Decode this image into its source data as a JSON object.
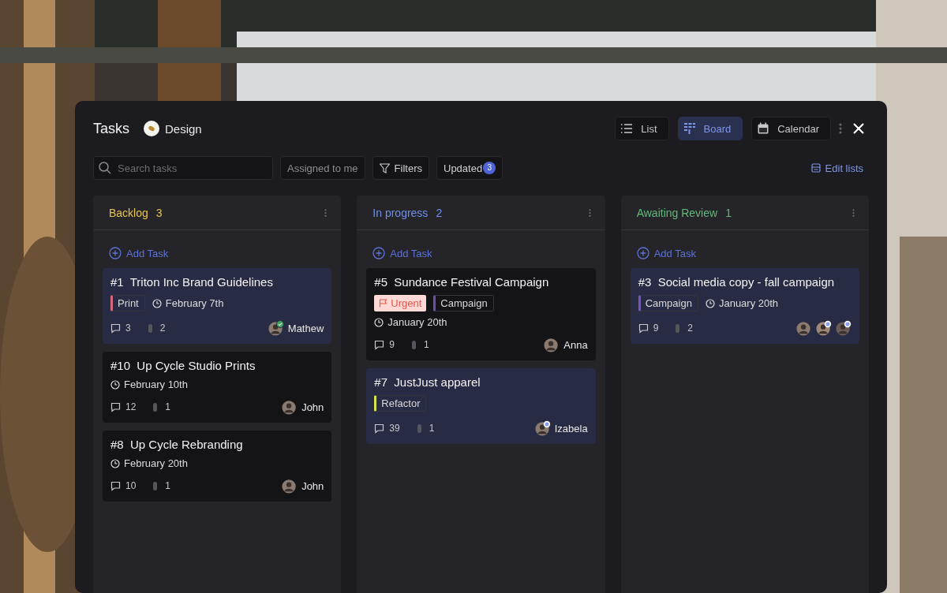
{
  "window": {
    "title": "Tasks",
    "project": "Design"
  },
  "views": [
    {
      "label": "List",
      "kind": "list",
      "selected": false
    },
    {
      "label": "Board",
      "kind": "board",
      "selected": true
    },
    {
      "label": "Calendar",
      "kind": "calendar",
      "selected": false
    }
  ],
  "toolbar": {
    "search": {
      "placeholder": "Search tasks"
    },
    "assigned": "Assigned to me",
    "filters": "Filters",
    "updated": {
      "label": "Updated",
      "count": "3"
    },
    "edit_lists": "Edit lists"
  },
  "columns": [
    {
      "title": "Backlog",
      "count": "3",
      "color": "#e8c34a",
      "add": "Add Task",
      "cards": [
        {
          "id": "#1",
          "title": "Triton Inc Brand Guidelines",
          "highlighted": true,
          "tags": [
            {
              "kind": "label",
              "text": "Print",
              "color": "#d46a7e"
            }
          ],
          "due": "February 7th",
          "comments": "3",
          "attachments": "2",
          "assignees": [
            {
              "name": "Mathew",
              "approved": true,
              "following": false
            }
          ]
        },
        {
          "id": "#10",
          "title": "Up Cycle Studio Prints",
          "highlighted": false,
          "due": "February 10th",
          "comments": "12",
          "attachments": "1",
          "assignees": [
            {
              "name": "John",
              "approved": false,
              "following": false
            }
          ]
        },
        {
          "id": "#8",
          "title": "Up Cycle Rebranding",
          "highlighted": false,
          "due": "February 20th",
          "comments": "10",
          "attachments": "1",
          "assignees": [
            {
              "name": "John",
              "approved": false,
              "following": false
            }
          ]
        }
      ]
    },
    {
      "title": "In progress",
      "count": "2",
      "color": "#6f8ee8",
      "add": "Add Task",
      "cards": [
        {
          "id": "#5",
          "title": "Sundance Festival Campaign",
          "highlighted": false,
          "tags": [
            {
              "kind": "urgent",
              "text": "Urgent",
              "color": "#ffd9d6"
            },
            {
              "kind": "label",
              "text": "Campaign",
              "color": "#6a4fb0"
            }
          ],
          "due": "January 20th",
          "comments": "9",
          "attachments": "1",
          "assignees": [
            {
              "name": "Anna",
              "approved": false,
              "following": false
            }
          ]
        },
        {
          "id": "#7",
          "title": "JustJust apparel",
          "highlighted": true,
          "tags": [
            {
              "kind": "label",
              "text": "Refactor",
              "color": "#d8e04a"
            }
          ],
          "comments": "39",
          "attachments": "1",
          "assignees": [
            {
              "name": "Izabela",
              "approved": false,
              "following": true
            }
          ]
        }
      ]
    },
    {
      "title": "Awaiting Review",
      "count": "1",
      "color": "#5fb87a",
      "add": "Add Task",
      "cards": [
        {
          "id": "#3",
          "title": "Social media copy - fall campaign",
          "highlighted": true,
          "tags": [
            {
              "kind": "label",
              "text": "Campaign",
              "color": "#7a55c0"
            }
          ],
          "due": "January 20th",
          "comments": "9",
          "attachments": "2",
          "assignees": [
            {
              "approved": false,
              "following": false
            },
            {
              "approved": false,
              "following": true
            },
            {
              "approved": false,
              "following": true
            }
          ]
        }
      ]
    }
  ]
}
